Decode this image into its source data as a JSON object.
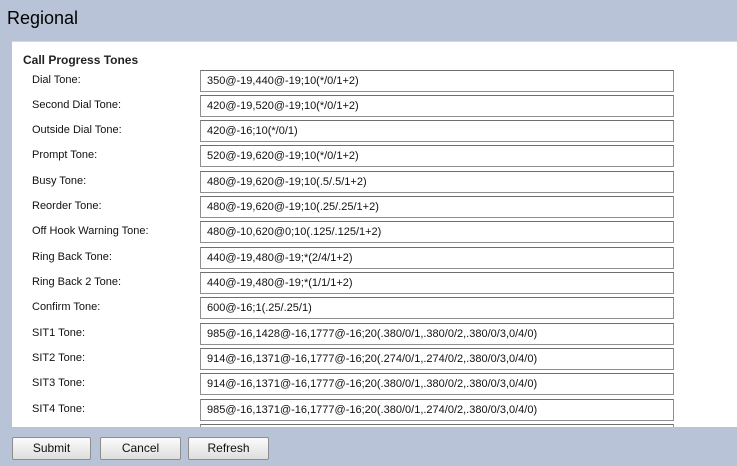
{
  "page": {
    "title": "Regional"
  },
  "section": {
    "title": "Call Progress Tones"
  },
  "tones": [
    {
      "label": "Dial Tone:",
      "value": "350@-19,440@-19;10(*/0/1+2)"
    },
    {
      "label": "Second Dial Tone:",
      "value": "420@-19,520@-19;10(*/0/1+2)"
    },
    {
      "label": "Outside Dial Tone:",
      "value": "420@-16;10(*/0/1)"
    },
    {
      "label": "Prompt Tone:",
      "value": "520@-19,620@-19;10(*/0/1+2)"
    },
    {
      "label": "Busy Tone:",
      "value": "480@-19,620@-19;10(.5/.5/1+2)"
    },
    {
      "label": "Reorder Tone:",
      "value": "480@-19,620@-19;10(.25/.25/1+2)"
    },
    {
      "label": "Off Hook Warning Tone:",
      "value": "480@-10,620@0;10(.125/.125/1+2)"
    },
    {
      "label": "Ring Back Tone:",
      "value": "440@-19,480@-19;*(2/4/1+2)"
    },
    {
      "label": "Ring Back 2 Tone:",
      "value": "440@-19,480@-19;*(1/1/1+2)"
    },
    {
      "label": "Confirm Tone:",
      "value": "600@-16;1(.25/.25/1)"
    },
    {
      "label": "SIT1 Tone:",
      "value": "985@-16,1428@-16,1777@-16;20(.380/0/1,.380/0/2,.380/0/3,0/4/0)"
    },
    {
      "label": "SIT2 Tone:",
      "value": "914@-16,1371@-16,1777@-16;20(.274/0/1,.274/0/2,.380/0/3,0/4/0)"
    },
    {
      "label": "SIT3 Tone:",
      "value": "914@-16,1371@-16,1777@-16;20(.380/0/1,.380/0/2,.380/0/3,0/4/0)"
    },
    {
      "label": "SIT4 Tone:",
      "value": "985@-16,1371@-16,1777@-16;20(.380/0/1,.274/0/2,.380/0/3,0/4/0)"
    }
  ],
  "buttons": {
    "submit": "Submit",
    "cancel": "Cancel",
    "refresh": "Refresh"
  }
}
